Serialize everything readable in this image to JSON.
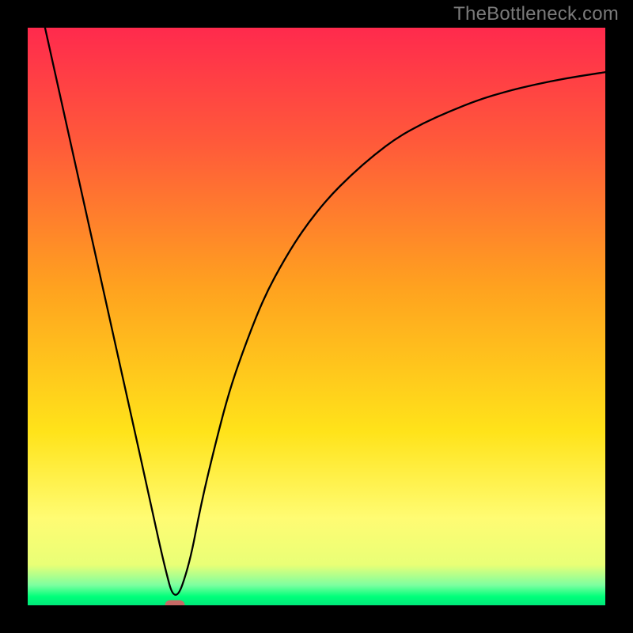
{
  "watermark": "TheBottleneck.com",
  "chart_data": {
    "type": "line",
    "title": "",
    "xlabel": "",
    "ylabel": "",
    "xlim": [
      0,
      100
    ],
    "ylim": [
      0,
      100
    ],
    "gradient_stops": [
      {
        "offset": 0,
        "color": "#ff2a4d"
      },
      {
        "offset": 20,
        "color": "#ff5a3a"
      },
      {
        "offset": 45,
        "color": "#ffa21f"
      },
      {
        "offset": 70,
        "color": "#ffe31a"
      },
      {
        "offset": 85,
        "color": "#fffc73"
      },
      {
        "offset": 93,
        "color": "#e9ff76"
      },
      {
        "offset": 96.5,
        "color": "#7dffa0"
      },
      {
        "offset": 98.5,
        "color": "#00ff7a"
      },
      {
        "offset": 100,
        "color": "#00e87a"
      }
    ],
    "series": [
      {
        "name": "bottleneck-curve",
        "x": [
          3.0,
          6.0,
          9.0,
          12.0,
          15.0,
          18.0,
          21.0,
          23.5,
          25.5,
          28.0,
          30.0,
          32.5,
          35.0,
          38.0,
          41.0,
          44.5,
          48.0,
          52.0,
          56.0,
          60.0,
          64.0,
          68.5,
          73.0,
          78.0,
          83.0,
          88.0,
          93.0,
          98.0,
          100.0
        ],
        "y": [
          100.0,
          86.5,
          73.0,
          59.5,
          46.0,
          32.5,
          19.0,
          7.5,
          0.0,
          7.0,
          17.5,
          28.0,
          37.5,
          46.0,
          53.5,
          60.0,
          65.5,
          70.5,
          74.5,
          78.0,
          81.0,
          83.5,
          85.5,
          87.5,
          89.0,
          90.2,
          91.2,
          92.0,
          92.3
        ]
      }
    ],
    "marker": {
      "x": 25.5,
      "y": 0.0,
      "color": "#c76a66"
    }
  }
}
